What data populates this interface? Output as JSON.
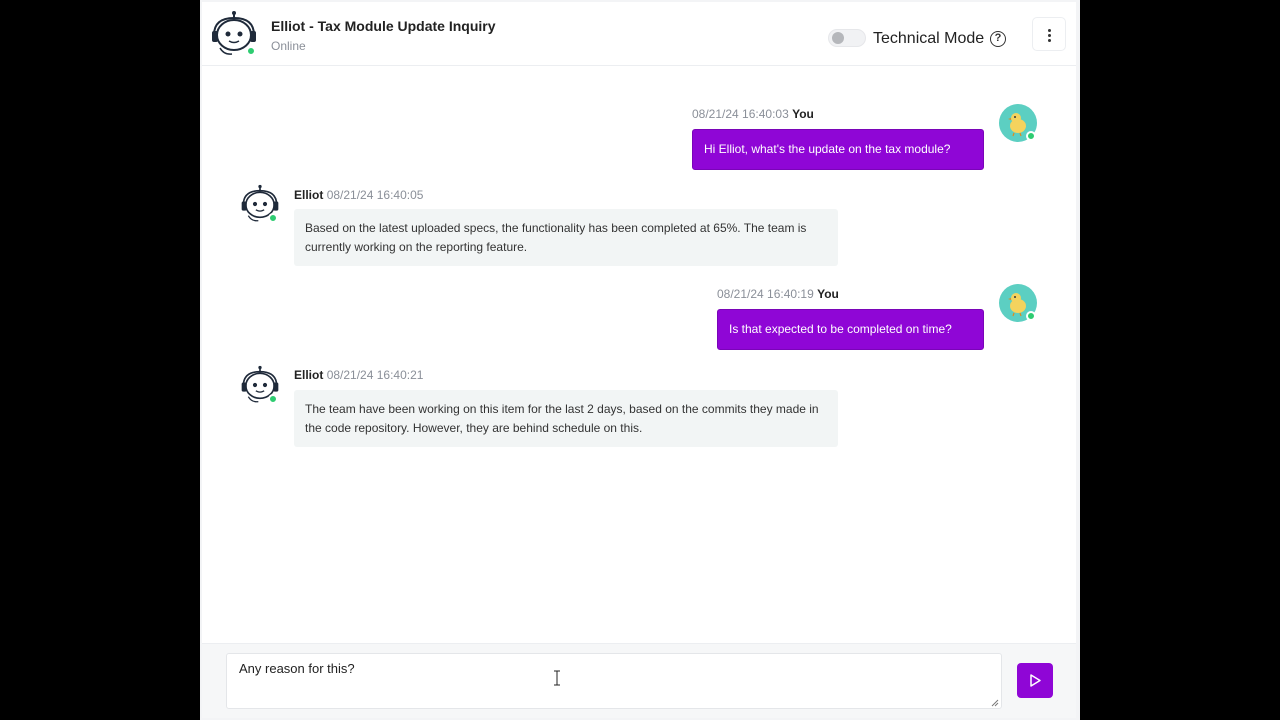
{
  "header": {
    "title": "Elliot - Tax Module Update Inquiry",
    "status": "Online",
    "technical_mode_label": "Technical Mode",
    "help_glyph": "?"
  },
  "messages": [
    {
      "sender": "You",
      "timestamp": "08/21/24 16:40:03",
      "text": "Hi Elliot, what's the update on the tax module?"
    },
    {
      "sender": "Elliot",
      "timestamp": "08/21/24 16:40:05",
      "text": "Based on the latest uploaded specs, the functionality has been completed at 65%. The team is currently working on the reporting feature."
    },
    {
      "sender": "You",
      "timestamp": "08/21/24 16:40:19",
      "text": "Is that expected to be completed on time?"
    },
    {
      "sender": "Elliot",
      "timestamp": "08/21/24 16:40:21",
      "text": "The team have been working on this item for the last 2 days, based on the commits they made in the code repository. However, they are behind schedule on this."
    }
  ],
  "composer": {
    "value": "Any reason for this?"
  },
  "colors": {
    "accent": "#8f06d6",
    "online": "#2ecc71",
    "bot_bubble": "#f2f5f5",
    "user_avatar_bg": "#5ccfc2"
  },
  "icons": {
    "bot_avatar": "robot-headset-icon",
    "user_avatar": "chick-icon",
    "menu": "kebab-menu-icon",
    "send": "send-triangle-icon",
    "help": "question-circle-icon"
  }
}
